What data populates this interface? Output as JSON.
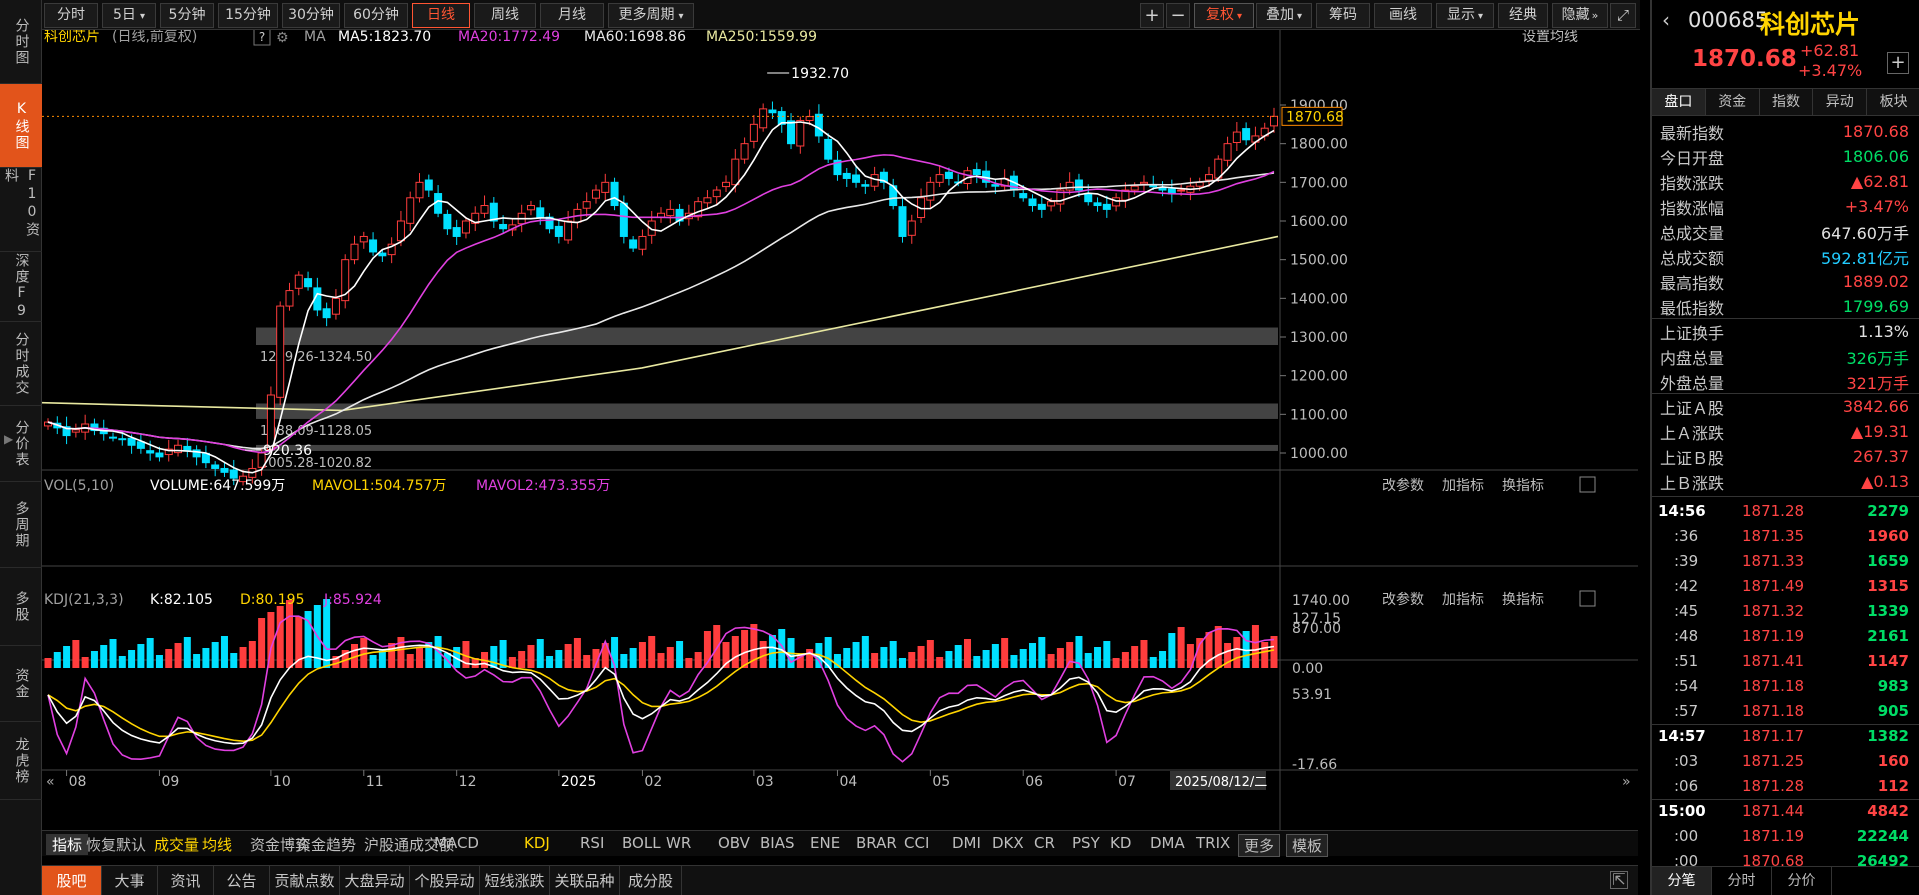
{
  "left_tabs": [
    {
      "label": "分时图",
      "active": false
    },
    {
      "label": "K线图",
      "active": true
    },
    {
      "label": "F10资料",
      "active": false
    },
    {
      "label": "深度F9",
      "active": false
    },
    {
      "label": "分时成交",
      "active": false
    },
    {
      "label": "分价表",
      "active": false
    },
    {
      "label": "多周期",
      "active": false
    },
    {
      "label": "多股",
      "active": false
    },
    {
      "label": "资金",
      "active": false
    },
    {
      "label": "龙虎榜",
      "active": false
    }
  ],
  "toolbar": {
    "periods": [
      "分时",
      "5日",
      "5分钟",
      "15分钟",
      "30分钟",
      "60分钟",
      "日线",
      "周线",
      "月线",
      "更多周期"
    ],
    "active_period": "日线",
    "right_buttons": [
      "复权",
      "叠加",
      "筹码",
      "画线",
      "显示",
      "经典",
      "隐藏"
    ]
  },
  "chart_header": {
    "name": "科创芯片",
    "mode": "(日线,前复权)",
    "ma_label": "MA",
    "ma5": "MA5:1823.70",
    "ma20": "MA20:1772.49",
    "ma60": "MA60:1698.86",
    "ma250": "MA250:1559.99",
    "settings": "设置均线"
  },
  "vol_header": {
    "label": "VOL(5,10)",
    "volume": "VOLUME:647.599万",
    "mavol1": "MAVOL1:504.757万",
    "mavol2": "MAVOL2:473.355万",
    "actions": [
      "改参数",
      "加指标",
      "换指标"
    ]
  },
  "kdj_header": {
    "label": "KDJ(21,3,3)",
    "k": "K:82.105",
    "d": "D:80.195",
    "j": "J:85.924",
    "actions": [
      "改参数",
      "加指标",
      "换指标"
    ]
  },
  "chart_data": {
    "type": "candlestick",
    "price_axis_ticks": [
      "1900.00",
      "1800.00",
      "1700.00",
      "1600.00",
      "1500.00",
      "1400.00",
      "1300.00",
      "1200.00",
      "1100.00",
      "1000.00"
    ],
    "current_price_label": "1870.68",
    "high_annotation": "1932.70",
    "low_annotation": "920.36",
    "zones": [
      {
        "label": "1279.26-1324.50",
        "low": 1279.26,
        "high": 1324.5
      },
      {
        "label": "1088.09-1128.05",
        "low": 1088.09,
        "high": 1128.05
      },
      {
        "label": "1005.28-1020.82",
        "low": 1005.28,
        "high": 1020.82
      }
    ],
    "x_ticks": [
      "08",
      "09",
      "10",
      "11",
      "12",
      "2025",
      "02",
      "03",
      "04",
      "05",
      "06",
      "07"
    ],
    "cursor_date": "2025/08/12/二",
    "close_series": [
      1080,
      1065,
      1045,
      1060,
      1075,
      1058,
      1050,
      1040,
      1035,
      1020,
      1012,
      1000,
      990,
      1010,
      1020,
      1005,
      990,
      975,
      960,
      950,
      935,
      940,
      960,
      1000,
      1150,
      1380,
      1420,
      1460,
      1430,
      1370,
      1350,
      1400,
      1500,
      1540,
      1560,
      1520,
      1510,
      1540,
      1600,
      1660,
      1700,
      1680,
      1620,
      1580,
      1560,
      1600,
      1620,
      1640,
      1600,
      1580,
      1590,
      1620,
      1640,
      1610,
      1580,
      1560,
      1600,
      1630,
      1650,
      1680,
      1700,
      1640,
      1560,
      1530,
      1560,
      1600,
      1620,
      1630,
      1600,
      1620,
      1650,
      1660,
      1680,
      1700,
      1760,
      1800,
      1850,
      1890,
      1880,
      1850,
      1800,
      1860,
      1870,
      1820,
      1760,
      1720,
      1710,
      1700,
      1690,
      1720,
      1700,
      1640,
      1560,
      1600,
      1660,
      1700,
      1720,
      1710,
      1700,
      1730,
      1720,
      1700,
      1690,
      1710,
      1680,
      1660,
      1640,
      1630,
      1650,
      1680,
      1700,
      1680,
      1650,
      1640,
      1630,
      1660,
      1680,
      1690,
      1700,
      1690,
      1680,
      1670,
      1680,
      1690,
      1700,
      1720,
      1760,
      1800,
      1830,
      1810,
      1820,
      1840,
      1870.68
    ],
    "ma250_range": [
      1130,
      1559.99
    ],
    "volume_axis_ticks": [
      "1740.00",
      "870.00",
      "0.00"
    ],
    "kdj_axis_ticks": [
      "127.15",
      "53.91",
      "-17.66"
    ]
  },
  "indicator_tabs": [
    "指标",
    "恢复默认",
    "成交量",
    "均线",
    "资金博弈",
    "资金趋势",
    "沪股通成交额",
    "MACD",
    "KDJ",
    "RSI",
    "BOLL",
    "WR",
    "OBV",
    "BIAS",
    "ENE",
    "BRAR",
    "CCI",
    "DMI",
    "DKX",
    "CR",
    "PSY",
    "KD",
    "DMA",
    "TRIX",
    "更多",
    "模板"
  ],
  "bottom_tabs": [
    "股吧",
    "大事",
    "资讯",
    "公告",
    "贡献点数",
    "大盘异动",
    "个股异动",
    "短线涨跌",
    "关联品种",
    "成分股"
  ],
  "quote": {
    "code": "000685",
    "name": "科创芯片",
    "price": "1870.68",
    "change": "+62.81",
    "change_pct": "+3.47%",
    "tabs": [
      "盘口",
      "资金",
      "指数",
      "异动",
      "板块"
    ]
  },
  "stats": [
    {
      "label": "最新指数",
      "value": "1870.68",
      "color": "#ff4444"
    },
    {
      "label": "今日开盘",
      "value": "1806.06",
      "color": "#00dd66"
    },
    {
      "label": "指数涨跌",
      "value": "▲62.81",
      "color": "#ff4444"
    },
    {
      "label": "指数涨幅",
      "value": "+3.47%",
      "color": "#ff4444"
    },
    {
      "label": "总成交量",
      "value": "647.60万手",
      "color": "#e0e0e0"
    },
    {
      "label": "总成交额",
      "value": "592.81亿元",
      "color": "#22ccff"
    },
    {
      "label": "最高指数",
      "value": "1889.02",
      "color": "#ff4444"
    },
    {
      "label": "最低指数",
      "value": "1799.69",
      "color": "#00dd66"
    },
    {
      "label": "上证换手",
      "value": "1.13%",
      "color": "#e0e0e0"
    },
    {
      "label": "内盘总量",
      "value": "326万手",
      "color": "#00dd66"
    },
    {
      "label": "外盘总量",
      "value": "321万手",
      "color": "#ff4444"
    },
    {
      "label": "上证Ａ股",
      "value": "3842.66",
      "color": "#ff4444"
    },
    {
      "label": "上Ａ涨跌",
      "value": "▲19.31",
      "color": "#ff4444"
    },
    {
      "label": "上证Ｂ股",
      "value": "267.37",
      "color": "#ff4444"
    },
    {
      "label": "上Ｂ涨跌",
      "value": "▲0.13",
      "color": "#ff4444"
    }
  ],
  "ticks": [
    {
      "time": "14:56",
      "price": "1871.28",
      "vol": "2279",
      "vol_color": "#00dd66",
      "bold": true
    },
    {
      "time": ":36",
      "price": "1871.35",
      "vol": "1960",
      "vol_color": "#ff4444",
      "bold": false
    },
    {
      "time": ":39",
      "price": "1871.33",
      "vol": "1659",
      "vol_color": "#00dd66",
      "bold": false
    },
    {
      "time": ":42",
      "price": "1871.49",
      "vol": "1315",
      "vol_color": "#ff4444",
      "bold": false
    },
    {
      "time": ":45",
      "price": "1871.32",
      "vol": "1339",
      "vol_color": "#00dd66",
      "bold": false
    },
    {
      "time": ":48",
      "price": "1871.19",
      "vol": "2161",
      "vol_color": "#00dd66",
      "bold": false
    },
    {
      "time": ":51",
      "price": "1871.41",
      "vol": "1147",
      "vol_color": "#ff4444",
      "bold": false
    },
    {
      "time": ":54",
      "price": "1871.18",
      "vol": "983",
      "vol_color": "#00dd66",
      "bold": false
    },
    {
      "time": ":57",
      "price": "1871.18",
      "vol": "905",
      "vol_color": "#00dd66",
      "bold": false
    },
    {
      "time": "14:57",
      "price": "1871.17",
      "vol": "1382",
      "vol_color": "#00dd66",
      "bold": true
    },
    {
      "time": ":03",
      "price": "1871.25",
      "vol": "160",
      "vol_color": "#ff4444",
      "bold": false
    },
    {
      "time": ":06",
      "price": "1871.28",
      "vol": "112",
      "vol_color": "#ff4444",
      "bold": false
    },
    {
      "time": "15:00",
      "price": "1871.44",
      "vol": "4842",
      "vol_color": "#ff4444",
      "bold": true
    },
    {
      "time": ":00",
      "price": "1871.19",
      "vol": "22244",
      "vol_color": "#00dd66",
      "bold": false
    },
    {
      "time": ":00",
      "price": "1870.68",
      "vol": "26492",
      "vol_color": "#00dd66",
      "bold": false
    }
  ],
  "right_bottom_tabs": [
    "分笔",
    "分时",
    "分价"
  ]
}
